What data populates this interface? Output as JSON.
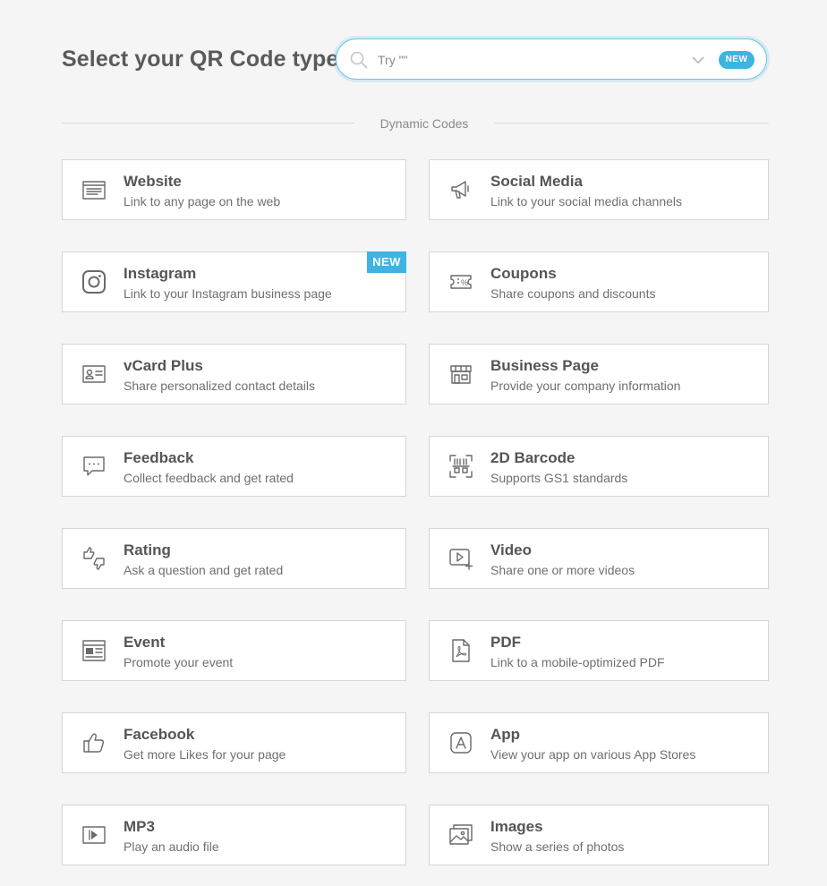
{
  "header": {
    "title": "Select your QR Code type"
  },
  "search": {
    "placeholder": "Try \"\"",
    "badge": "NEW"
  },
  "section": {
    "label": "Dynamic Codes"
  },
  "cards": [
    {
      "id": "website",
      "icon": "website-icon",
      "title": "Website",
      "desc": "Link to any page on the web"
    },
    {
      "id": "social-media",
      "icon": "megaphone-icon",
      "title": "Social Media",
      "desc": "Link to your social media channels"
    },
    {
      "id": "instagram",
      "icon": "instagram-icon",
      "title": "Instagram",
      "desc": "Link to your Instagram business page",
      "badge": "NEW"
    },
    {
      "id": "coupons",
      "icon": "coupon-icon",
      "title": "Coupons",
      "desc": "Share coupons and discounts"
    },
    {
      "id": "vcard-plus",
      "icon": "contact-card-icon",
      "title": "vCard Plus",
      "desc": "Share personalized contact details"
    },
    {
      "id": "business-page",
      "icon": "storefront-icon",
      "title": "Business Page",
      "desc": "Provide your company information"
    },
    {
      "id": "feedback",
      "icon": "chat-bubble-icon",
      "title": "Feedback",
      "desc": "Collect feedback and get rated"
    },
    {
      "id": "2d-barcode",
      "icon": "barcode-icon",
      "title": "2D Barcode",
      "desc": "Supports GS1 standards"
    },
    {
      "id": "rating",
      "icon": "thumbs-up-down-icon",
      "title": "Rating",
      "desc": "Ask a question and get rated"
    },
    {
      "id": "video",
      "icon": "video-add-icon",
      "title": "Video",
      "desc": "Share one or more videos"
    },
    {
      "id": "event",
      "icon": "calendar-icon",
      "title": "Event",
      "desc": "Promote your event"
    },
    {
      "id": "pdf",
      "icon": "pdf-icon",
      "title": "PDF",
      "desc": "Link to a mobile-optimized PDF"
    },
    {
      "id": "facebook",
      "icon": "thumbs-up-icon",
      "title": "Facebook",
      "desc": "Get more Likes for your page"
    },
    {
      "id": "app",
      "icon": "app-store-icon",
      "title": "App",
      "desc": "View your app on various App Stores"
    },
    {
      "id": "mp3",
      "icon": "audio-play-icon",
      "title": "MP3",
      "desc": "Play an audio file"
    },
    {
      "id": "images",
      "icon": "images-icon",
      "title": "Images",
      "desc": "Show a series of photos"
    }
  ]
}
